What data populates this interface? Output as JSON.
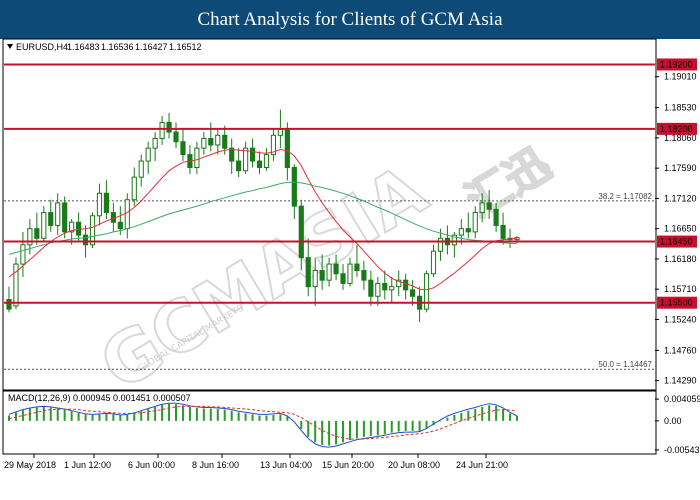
{
  "banner": {
    "title": "Chart Analysis for Clients of GCM Asia"
  },
  "instrument": {
    "label": "EURUSD,H4",
    "open": "1.16483",
    "high": "1.16536",
    "low": "1.16427",
    "close": "1.16512"
  },
  "watermark": {
    "text": "GCMASIA",
    "cn": "汇迅",
    "sub": "GLOBAL CAPITAL MARKETS"
  },
  "colors": {
    "banner": "#0e4a78",
    "level_line": "#c8102e",
    "level_tag": "#c8102e",
    "candle": "#1a7a1a",
    "ma_fast": "#e0303a",
    "ma_slow": "#3aaa6a",
    "macd_line": "#2050d0",
    "macd_signal": "#e03030",
    "macd_hist": "#2a9a2a"
  },
  "chart_data": {
    "type": "candlestick",
    "symbol": "EURUSD",
    "timeframe": "H4",
    "ylim": [
      1.1416,
      1.1958
    ],
    "y_ticks": [
      "1.19010",
      "1.18530",
      "1.18060",
      "1.17590",
      "1.17120",
      "1.16650",
      "1.16180",
      "1.15710",
      "1.15240",
      "1.14760",
      "1.14290"
    ],
    "x_ticks": [
      "29 May 2018",
      "1 Jun 12:00",
      "6 Jun 00:00",
      "8 Jun 16:00",
      "13 Jun 04:00",
      "15 Jun 20:00",
      "20 Jun 08:00",
      "24 Jun 21:00"
    ],
    "levels": [
      {
        "price": 1.192,
        "label": "1.19200"
      },
      {
        "price": 1.182,
        "label": "1.18200"
      },
      {
        "price": 1.1645,
        "label": "1.16450"
      },
      {
        "price": 1.155,
        "label": "1.15500"
      }
    ],
    "fib_levels": [
      {
        "price": 1.17082,
        "label": "38.2 = 1.17082"
      },
      {
        "price": 1.14467,
        "label": "50.0 = 1.14467"
      }
    ],
    "candles": [
      {
        "o": 1.1555,
        "h": 1.1575,
        "l": 1.1535,
        "c": 1.154
      },
      {
        "o": 1.1545,
        "h": 1.162,
        "l": 1.154,
        "c": 1.161
      },
      {
        "o": 1.161,
        "h": 1.166,
        "l": 1.159,
        "c": 1.164
      },
      {
        "o": 1.164,
        "h": 1.168,
        "l": 1.1625,
        "c": 1.1665
      },
      {
        "o": 1.1665,
        "h": 1.169,
        "l": 1.164,
        "c": 1.165
      },
      {
        "o": 1.165,
        "h": 1.17,
        "l": 1.1645,
        "c": 1.169
      },
      {
        "o": 1.169,
        "h": 1.171,
        "l": 1.166,
        "c": 1.167
      },
      {
        "o": 1.167,
        "h": 1.172,
        "l": 1.1655,
        "c": 1.1705
      },
      {
        "o": 1.1705,
        "h": 1.1715,
        "l": 1.165,
        "c": 1.166
      },
      {
        "o": 1.166,
        "h": 1.168,
        "l": 1.164,
        "c": 1.1675
      },
      {
        "o": 1.1675,
        "h": 1.169,
        "l": 1.1645,
        "c": 1.1655
      },
      {
        "o": 1.1655,
        "h": 1.167,
        "l": 1.162,
        "c": 1.164
      },
      {
        "o": 1.164,
        "h": 1.169,
        "l": 1.1635,
        "c": 1.1685
      },
      {
        "o": 1.1685,
        "h": 1.1735,
        "l": 1.167,
        "c": 1.172
      },
      {
        "o": 1.172,
        "h": 1.174,
        "l": 1.168,
        "c": 1.169
      },
      {
        "o": 1.169,
        "h": 1.1705,
        "l": 1.166,
        "c": 1.1675
      },
      {
        "o": 1.1675,
        "h": 1.17,
        "l": 1.1655,
        "c": 1.1665
      },
      {
        "o": 1.1665,
        "h": 1.172,
        "l": 1.165,
        "c": 1.171
      },
      {
        "o": 1.171,
        "h": 1.176,
        "l": 1.17,
        "c": 1.1745
      },
      {
        "o": 1.1745,
        "h": 1.178,
        "l": 1.173,
        "c": 1.177
      },
      {
        "o": 1.177,
        "h": 1.18,
        "l": 1.175,
        "c": 1.179
      },
      {
        "o": 1.179,
        "h": 1.1815,
        "l": 1.177,
        "c": 1.1805
      },
      {
        "o": 1.1805,
        "h": 1.184,
        "l": 1.1795,
        "c": 1.183
      },
      {
        "o": 1.183,
        "h": 1.1845,
        "l": 1.1805,
        "c": 1.1815
      },
      {
        "o": 1.1815,
        "h": 1.183,
        "l": 1.179,
        "c": 1.18
      },
      {
        "o": 1.18,
        "h": 1.182,
        "l": 1.177,
        "c": 1.178
      },
      {
        "o": 1.178,
        "h": 1.1795,
        "l": 1.175,
        "c": 1.176
      },
      {
        "o": 1.176,
        "h": 1.18,
        "l": 1.175,
        "c": 1.179
      },
      {
        "o": 1.179,
        "h": 1.1815,
        "l": 1.178,
        "c": 1.1805
      },
      {
        "o": 1.1805,
        "h": 1.183,
        "l": 1.1785,
        "c": 1.1795
      },
      {
        "o": 1.1795,
        "h": 1.182,
        "l": 1.178,
        "c": 1.181
      },
      {
        "o": 1.181,
        "h": 1.1825,
        "l": 1.178,
        "c": 1.179
      },
      {
        "o": 1.179,
        "h": 1.1805,
        "l": 1.175,
        "c": 1.177
      },
      {
        "o": 1.177,
        "h": 1.179,
        "l": 1.1745,
        "c": 1.1755
      },
      {
        "o": 1.1755,
        "h": 1.18,
        "l": 1.175,
        "c": 1.179
      },
      {
        "o": 1.179,
        "h": 1.1805,
        "l": 1.176,
        "c": 1.177
      },
      {
        "o": 1.177,
        "h": 1.1785,
        "l": 1.175,
        "c": 1.176
      },
      {
        "o": 1.176,
        "h": 1.179,
        "l": 1.1755,
        "c": 1.178
      },
      {
        "o": 1.178,
        "h": 1.182,
        "l": 1.177,
        "c": 1.181
      },
      {
        "o": 1.181,
        "h": 1.185,
        "l": 1.179,
        "c": 1.182
      },
      {
        "o": 1.182,
        "h": 1.183,
        "l": 1.174,
        "c": 1.176
      },
      {
        "o": 1.176,
        "h": 1.1765,
        "l": 1.168,
        "c": 1.17
      },
      {
        "o": 1.17,
        "h": 1.171,
        "l": 1.16,
        "c": 1.162
      },
      {
        "o": 1.162,
        "h": 1.165,
        "l": 1.156,
        "c": 1.1575
      },
      {
        "o": 1.1575,
        "h": 1.162,
        "l": 1.1545,
        "c": 1.16
      },
      {
        "o": 1.16,
        "h": 1.1625,
        "l": 1.157,
        "c": 1.1585
      },
      {
        "o": 1.1585,
        "h": 1.162,
        "l": 1.1575,
        "c": 1.161
      },
      {
        "o": 1.161,
        "h": 1.1625,
        "l": 1.1585,
        "c": 1.1595
      },
      {
        "o": 1.1595,
        "h": 1.161,
        "l": 1.157,
        "c": 1.158
      },
      {
        "o": 1.158,
        "h": 1.162,
        "l": 1.1575,
        "c": 1.161
      },
      {
        "o": 1.161,
        "h": 1.164,
        "l": 1.159,
        "c": 1.16
      },
      {
        "o": 1.16,
        "h": 1.1615,
        "l": 1.157,
        "c": 1.1585
      },
      {
        "o": 1.1585,
        "h": 1.16,
        "l": 1.1545,
        "c": 1.156
      },
      {
        "o": 1.156,
        "h": 1.159,
        "l": 1.1545,
        "c": 1.158
      },
      {
        "o": 1.158,
        "h": 1.16,
        "l": 1.1555,
        "c": 1.157
      },
      {
        "o": 1.157,
        "h": 1.159,
        "l": 1.155,
        "c": 1.1575
      },
      {
        "o": 1.1575,
        "h": 1.16,
        "l": 1.156,
        "c": 1.1585
      },
      {
        "o": 1.1585,
        "h": 1.1595,
        "l": 1.1555,
        "c": 1.157
      },
      {
        "o": 1.157,
        "h": 1.1585,
        "l": 1.1545,
        "c": 1.156
      },
      {
        "o": 1.156,
        "h": 1.1575,
        "l": 1.152,
        "c": 1.154
      },
      {
        "o": 1.154,
        "h": 1.16,
        "l": 1.1535,
        "c": 1.1595
      },
      {
        "o": 1.1595,
        "h": 1.164,
        "l": 1.159,
        "c": 1.163
      },
      {
        "o": 1.163,
        "h": 1.1665,
        "l": 1.1615,
        "c": 1.165
      },
      {
        "o": 1.165,
        "h": 1.167,
        "l": 1.1625,
        "c": 1.164
      },
      {
        "o": 1.164,
        "h": 1.166,
        "l": 1.162,
        "c": 1.1655
      },
      {
        "o": 1.1655,
        "h": 1.168,
        "l": 1.164,
        "c": 1.1665
      },
      {
        "o": 1.1665,
        "h": 1.169,
        "l": 1.165,
        "c": 1.166
      },
      {
        "o": 1.166,
        "h": 1.17,
        "l": 1.165,
        "c": 1.169
      },
      {
        "o": 1.169,
        "h": 1.172,
        "l": 1.1675,
        "c": 1.1705
      },
      {
        "o": 1.1705,
        "h": 1.1725,
        "l": 1.168,
        "c": 1.1695
      },
      {
        "o": 1.1695,
        "h": 1.1705,
        "l": 1.166,
        "c": 1.167
      },
      {
        "o": 1.167,
        "h": 1.169,
        "l": 1.164,
        "c": 1.165
      },
      {
        "o": 1.165,
        "h": 1.1665,
        "l": 1.1635,
        "c": 1.1648
      },
      {
        "o": 1.1648,
        "h": 1.1654,
        "l": 1.1643,
        "c": 1.1651
      }
    ],
    "ma_fast": [
      1.159,
      1.1598,
      1.1607,
      1.1617,
      1.1626,
      1.1636,
      1.1645,
      1.1652,
      1.1658,
      1.1662,
      1.1664,
      1.1665,
      1.1667,
      1.1672,
      1.1677,
      1.1681,
      1.1685,
      1.169,
      1.1698,
      1.1708,
      1.172,
      1.1732,
      1.1744,
      1.1755,
      1.1762,
      1.1768,
      1.177,
      1.1772,
      1.1776,
      1.178,
      1.1784,
      1.1787,
      1.1788,
      1.1787,
      1.1786,
      1.1785,
      1.1783,
      1.1782,
      1.1784,
      1.1788,
      1.1786,
      1.1778,
      1.1763,
      1.1742,
      1.1722,
      1.1705,
      1.169,
      1.1676,
      1.1663,
      1.1652,
      1.1642,
      1.163,
      1.1618,
      1.1606,
      1.1596,
      1.1588,
      1.1583,
      1.158,
      1.1576,
      1.1571,
      1.157,
      1.1573,
      1.158,
      1.1588,
      1.1596,
      1.1605,
      1.1614,
      1.1624,
      1.1634,
      1.1642,
      1.1646,
      1.1648,
      1.1649,
      1.165
    ],
    "ma_slow": [
      1.1625,
      1.1628,
      1.1631,
      1.1634,
      1.1637,
      1.164,
      1.1643,
      1.1645,
      1.1647,
      1.1649,
      1.165,
      1.1651,
      1.1653,
      1.1655,
      1.1657,
      1.166,
      1.1662,
      1.1665,
      1.1668,
      1.1672,
      1.1676,
      1.168,
      1.1684,
      1.1688,
      1.1691,
      1.1694,
      1.1697,
      1.17,
      1.1703,
      1.1707,
      1.171,
      1.1713,
      1.1716,
      1.1719,
      1.1722,
      1.1724,
      1.1727,
      1.1729,
      1.1732,
      1.1735,
      1.1737,
      1.1737,
      1.1736,
      1.1734,
      1.1731,
      1.1729,
      1.1726,
      1.1723,
      1.172,
      1.1716,
      1.1712,
      1.1708,
      1.1703,
      1.1698,
      1.1694,
      1.1689,
      1.1684,
      1.1679,
      1.1674,
      1.1669,
      1.1665,
      1.1661,
      1.1658,
      1.1655,
      1.1652,
      1.165,
      1.1648,
      1.1647,
      1.1646,
      1.1645,
      1.1644,
      1.1643,
      1.1642,
      1.1642
    ],
    "macd": {
      "label": "MACD(12,26,9) 0.000945 0.001451 0.000507",
      "ylim": [
        -0.006,
        0.0052
      ],
      "y_ticks": [
        "0.004059",
        "0.00",
        "-0.00543"
      ],
      "hist": [
        0.001,
        0.0016,
        0.002,
        0.0023,
        0.0025,
        0.0026,
        0.0025,
        0.0023,
        0.0021,
        0.0018,
        0.0015,
        0.0012,
        0.0011,
        0.0012,
        0.0013,
        0.0012,
        0.001,
        0.0011,
        0.0014,
        0.0018,
        0.0022,
        0.0026,
        0.003,
        0.0032,
        0.0031,
        0.0029,
        0.0026,
        0.0024,
        0.0023,
        0.0023,
        0.0022,
        0.0021,
        0.0019,
        0.0016,
        0.0014,
        0.0012,
        0.001,
        0.001,
        0.0011,
        0.0012,
        0.0008,
        0.0,
        -0.0015,
        -0.003,
        -0.004,
        -0.0045,
        -0.0046,
        -0.0044,
        -0.004,
        -0.0036,
        -0.0032,
        -0.003,
        -0.0028,
        -0.0027,
        -0.0025,
        -0.0022,
        -0.002,
        -0.0019,
        -0.0019,
        -0.002,
        -0.0015,
        -0.0008,
        -0.0001,
        0.0006,
        0.0011,
        0.0015,
        0.0019,
        0.0022,
        0.0026,
        0.0029,
        0.0028,
        0.0022,
        0.0014,
        0.0009
      ],
      "line": [
        0.0012,
        0.0017,
        0.0021,
        0.0024,
        0.0026,
        0.0027,
        0.0026,
        0.0024,
        0.0022,
        0.0019,
        0.0016,
        0.0013,
        0.0012,
        0.0013,
        0.0014,
        0.0013,
        0.0011,
        0.0012,
        0.0015,
        0.0019,
        0.0023,
        0.0027,
        0.0031,
        0.0033,
        0.0033,
        0.0031,
        0.0028,
        0.0026,
        0.0025,
        0.0025,
        0.0024,
        0.0023,
        0.0021,
        0.0018,
        0.0016,
        0.0014,
        0.0012,
        0.0012,
        0.0013,
        0.0014,
        0.0009,
        -0.0002,
        -0.0018,
        -0.0033,
        -0.0043,
        -0.0048,
        -0.0049,
        -0.0047,
        -0.0043,
        -0.0039,
        -0.0035,
        -0.0033,
        -0.0031,
        -0.0029,
        -0.0027,
        -0.0024,
        -0.0022,
        -0.0021,
        -0.0021,
        -0.002,
        -0.0014,
        -0.0006,
        0.0002,
        0.0009,
        0.0014,
        0.0018,
        0.0022,
        0.0025,
        0.0029,
        0.0032,
        0.003,
        0.0024,
        0.0016,
        0.0009
      ],
      "signal": [
        0.0004,
        0.0007,
        0.001,
        0.0013,
        0.0016,
        0.0019,
        0.0021,
        0.0022,
        0.0022,
        0.0022,
        0.0021,
        0.0019,
        0.0018,
        0.0017,
        0.0016,
        0.0015,
        0.0014,
        0.0014,
        0.0014,
        0.0015,
        0.0017,
        0.0019,
        0.0021,
        0.0024,
        0.0026,
        0.0027,
        0.0027,
        0.0027,
        0.0027,
        0.0026,
        0.0026,
        0.0025,
        0.0024,
        0.0023,
        0.0022,
        0.0021,
        0.0019,
        0.0018,
        0.0017,
        0.0016,
        0.0015,
        0.0012,
        0.0006,
        -0.0002,
        -0.001,
        -0.0018,
        -0.0024,
        -0.0029,
        -0.0032,
        -0.0034,
        -0.0034,
        -0.0034,
        -0.0033,
        -0.0032,
        -0.0031,
        -0.0029,
        -0.0028,
        -0.0026,
        -0.0025,
        -0.0024,
        -0.0022,
        -0.0019,
        -0.0015,
        -0.001,
        -0.0005,
        0.0,
        0.0005,
        0.0009,
        0.0013,
        0.0017,
        0.002,
        0.0021,
        0.002,
        0.0018
      ]
    }
  }
}
